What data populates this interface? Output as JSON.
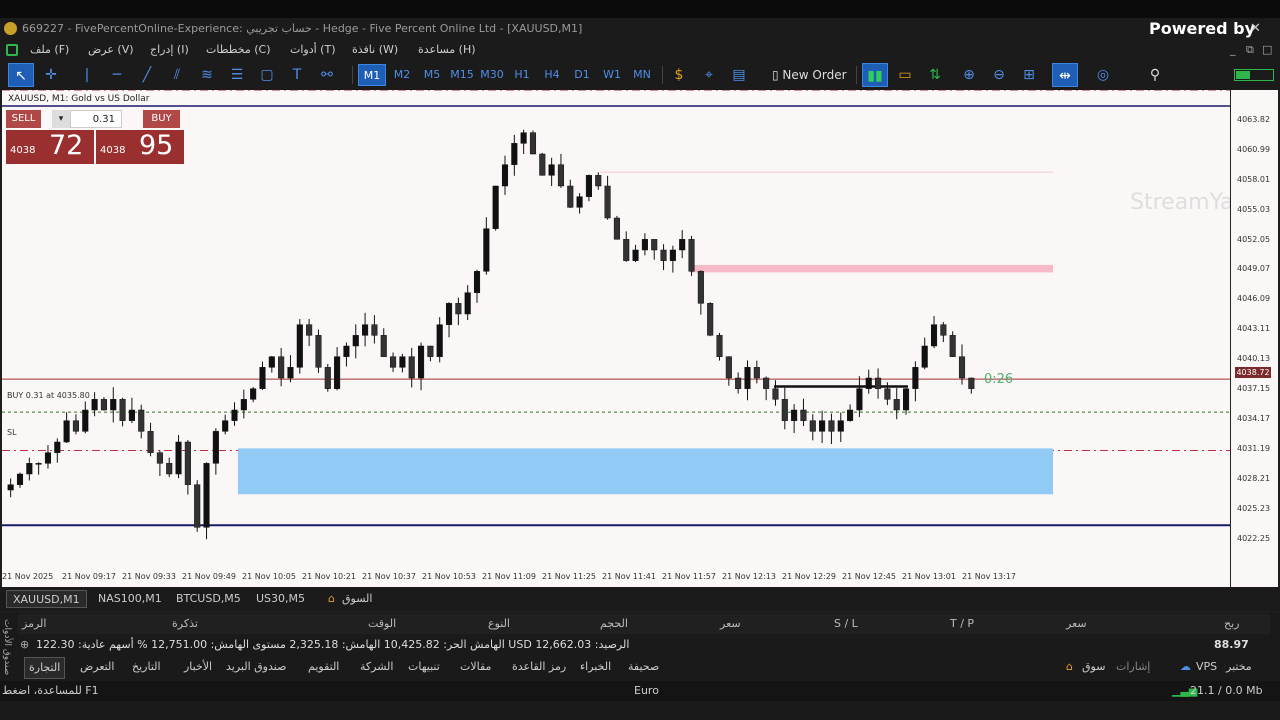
{
  "window": {
    "title": "669227 - FivePercentOnline-Experience: حساب تجريبي - Hedge - Five Percent Online Ltd - [XAUUSD,M1]",
    "powered_by": "Powered by"
  },
  "menu": [
    "ملف (F)",
    "عرض (V)",
    "إدراج (I)",
    "مخططات (C)",
    "أدوات (T)",
    "نافذة (W)",
    "مساعدة (H)"
  ],
  "toolbar": {
    "timeframes": [
      "M1",
      "M2",
      "M5",
      "M15",
      "M30",
      "H1",
      "H4",
      "D1",
      "W1",
      "MN"
    ],
    "selected_timeframe": "M1",
    "new_order": "New Order"
  },
  "chart": {
    "title": "XAUUSD, M1: Gold vs US Dollar",
    "trade_panel": {
      "sell": "SELL",
      "buy": "BUY",
      "lot": "0.31",
      "sell_small": "4038",
      "sell_big": "72",
      "buy_small": "4038",
      "buy_big": "95"
    },
    "price_labels": [
      "4063.82",
      "4060.99",
      "4058.01",
      "4055.03",
      "4052.05",
      "4049.07",
      "4046.09",
      "4043.11",
      "4040.13",
      "4037.15",
      "4034.17",
      "4031.19",
      "4028.21",
      "4025.23",
      "4022.25"
    ],
    "current_price": "4038.72",
    "time_labels": [
      "21 Nov 2025",
      "21 Nov 09:17",
      "21 Nov 09:33",
      "21 Nov 09:49",
      "21 Nov 10:05",
      "21 Nov 10:21",
      "21 Nov 10:37",
      "21 Nov 10:53",
      "21 Nov 11:09",
      "21 Nov 11:25",
      "21 Nov 11:41",
      "21 Nov 11:57",
      "21 Nov 12:13",
      "21 Nov 12:29",
      "21 Nov 12:45",
      "21 Nov 13:01",
      "21 Nov 13:17"
    ],
    "timer": "0:26",
    "buy_label": "BUY 0.31 at 4035.80",
    "sl_label": "SL",
    "watermark": "StreamYard"
  },
  "chart_tabs": [
    "XAUUSD,M1",
    "NAS100,M1",
    "BTCUSD,M5",
    "US30,M5",
    "السوق"
  ],
  "toolbox": {
    "columns": [
      "الرمز",
      "تذكرة",
      "الوقت",
      "النوع",
      "الحجم",
      "سعر",
      "S / L",
      "T / P",
      "سعر",
      "ربح"
    ],
    "balance": "الرصيد: 12,662.03 USD  الهامش الحر: 10,425.82  الهامش: 2,325.18  مستوى الهامش: 12,751.00 %  أسهم عادية: 122.30",
    "profit": "88.97",
    "tabs": [
      "التجارة",
      "التعرض",
      "التاريخ",
      "الأخبار",
      "صندوق البريد",
      "التقويم",
      "الشركة",
      "تنبيهات",
      "مقالات",
      "رمز القاعدة",
      "الخبراء",
      "صحيفة"
    ],
    "right_tabs": [
      "سوق",
      "إشارات",
      "VPS",
      "مختبر"
    ],
    "side_label": "صندوق الأدوات"
  },
  "statusbar": {
    "help": "للمساعدة، اضغط F1",
    "profile": "Euro",
    "traffic": "21.1 / 0.0 Mb"
  },
  "chart_data": {
    "type": "candlestick",
    "symbol": "XAUUSD",
    "timeframe": "M1",
    "ylim": [
      4021,
      4066
    ],
    "series": [
      {
        "name": "XAUUSD",
        "values": [
          4029,
          4030,
          4031,
          4031,
          4032,
          4033,
          4035,
          4034,
          4036,
          4037,
          4036,
          4037,
          4035,
          4036,
          4034,
          4032,
          4031,
          4030,
          4033,
          4029,
          4025,
          4031,
          4034,
          4035,
          4036,
          4037,
          4038,
          4040,
          4041,
          4039,
          4040,
          4044,
          4043,
          4040,
          4038,
          4041,
          4042,
          4043,
          4044,
          4043,
          4041,
          4040,
          4041,
          4039,
          4042,
          4041,
          4044,
          4046,
          4045,
          4047,
          4049,
          4053,
          4057,
          4059,
          4061,
          4062,
          4060,
          4058,
          4059,
          4057,
          4055,
          4056,
          4058,
          4057,
          4054,
          4052,
          4050,
          4051,
          4052,
          4051,
          4050,
          4051,
          4052,
          4049,
          4046,
          4043,
          4041,
          4039,
          4038,
          4040,
          4039,
          4038,
          4037,
          4035,
          4036,
          4035,
          4034,
          4035,
          4034,
          4035,
          4036,
          4038,
          4039,
          4038,
          4037,
          4036,
          4038,
          4040,
          4042,
          4044,
          4043,
          4041,
          4039,
          4038
        ]
      }
    ]
  }
}
